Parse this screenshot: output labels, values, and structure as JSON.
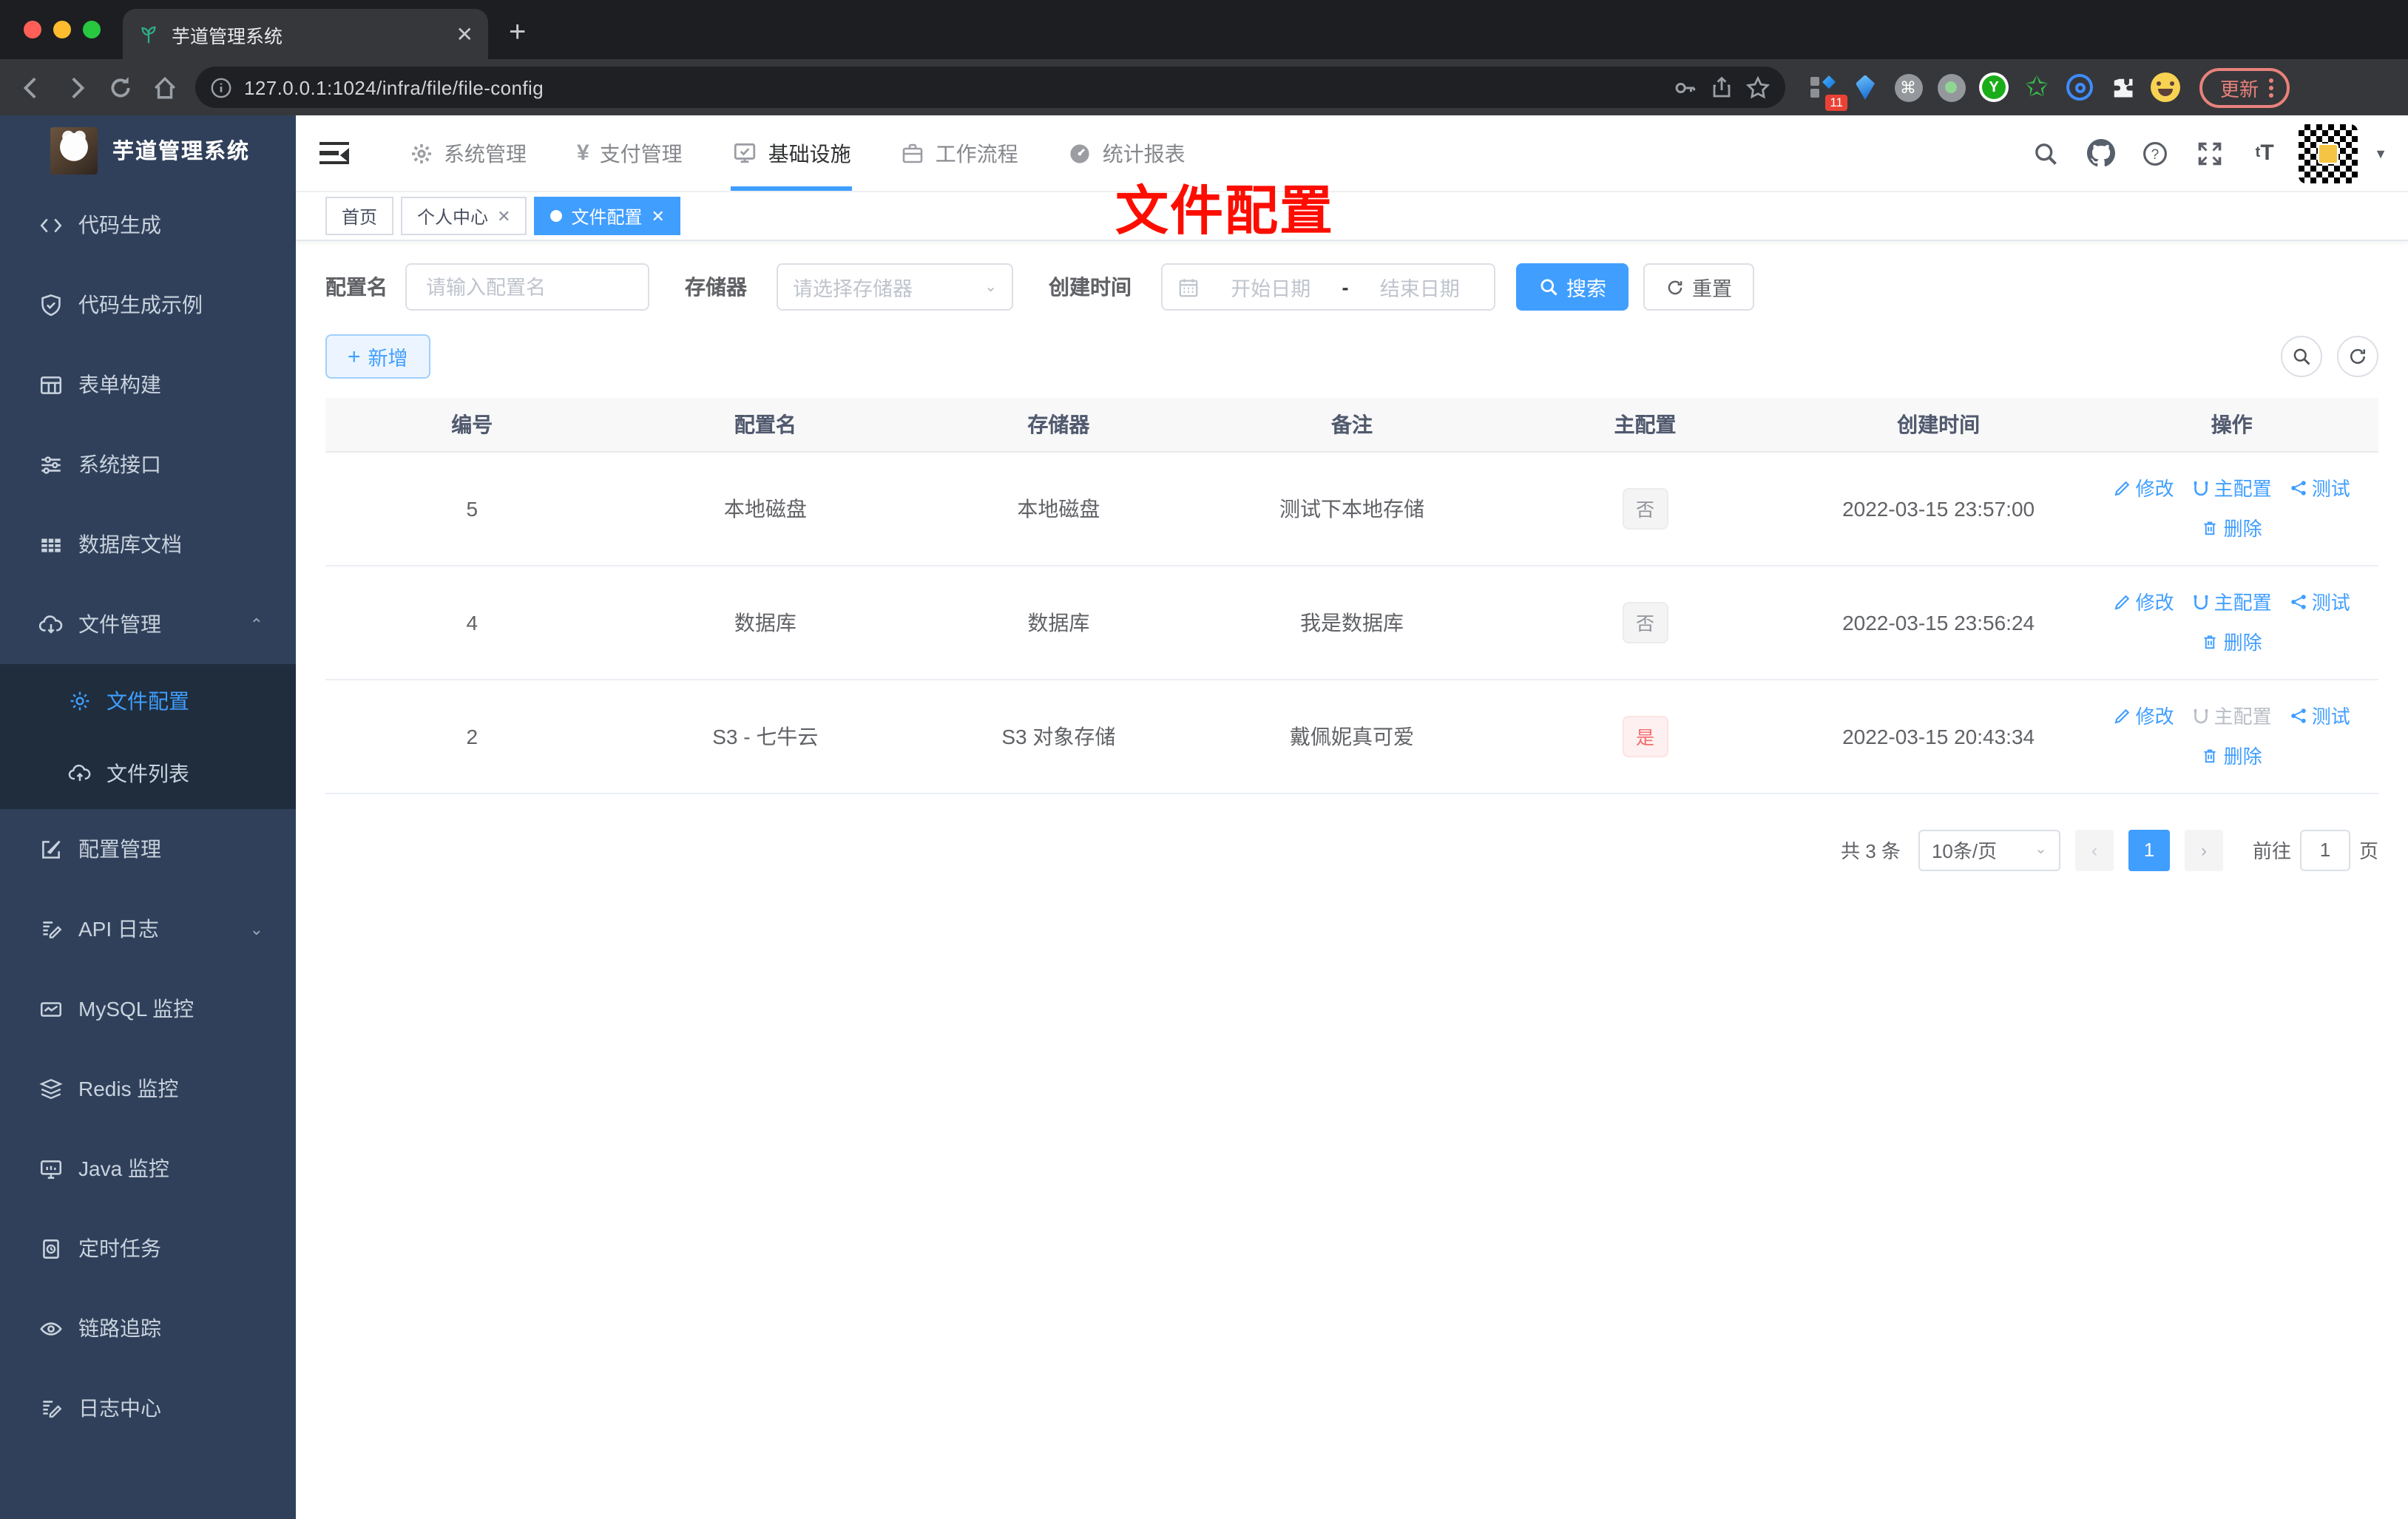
{
  "browser": {
    "tab_title": "芋道管理系统",
    "url": "127.0.0.1:1024/infra/file/file-config",
    "update_label": "更新",
    "extensions_badge": "11"
  },
  "sidebar": {
    "title": "芋道管理系统",
    "items": [
      {
        "label": "代码生成"
      },
      {
        "label": "代码生成示例"
      },
      {
        "label": "表单构建"
      },
      {
        "label": "系统接口"
      },
      {
        "label": "数据库文档"
      },
      {
        "label": "文件管理"
      },
      {
        "label": "文件配置"
      },
      {
        "label": "文件列表"
      },
      {
        "label": "配置管理"
      },
      {
        "label": "API 日志"
      },
      {
        "label": "MySQL 监控"
      },
      {
        "label": "Redis 监控"
      },
      {
        "label": "Java 监控"
      },
      {
        "label": "定时任务"
      },
      {
        "label": "链路追踪"
      },
      {
        "label": "日志中心"
      }
    ]
  },
  "topnav": {
    "items": [
      {
        "label": "系统管理"
      },
      {
        "label": "支付管理"
      },
      {
        "label": "基础设施"
      },
      {
        "label": "工作流程"
      },
      {
        "label": "统计报表"
      }
    ]
  },
  "tags": {
    "home": "首页",
    "profile": "个人中心",
    "current": "文件配置"
  },
  "annotation": {
    "title": "文件配置"
  },
  "filters": {
    "name_label": "配置名",
    "name_placeholder": "请输入配置名",
    "storage_label": "存储器",
    "storage_placeholder": "请选择存储器",
    "time_label": "创建时间",
    "start_placeholder": "开始日期",
    "separator": "-",
    "end_placeholder": "结束日期",
    "search_label": "搜索",
    "reset_label": "重置"
  },
  "toolbar": {
    "add_label": "新增"
  },
  "table": {
    "headers": [
      "编号",
      "配置名",
      "存储器",
      "备注",
      "主配置",
      "创建时间",
      "操作"
    ],
    "actions": {
      "edit": "修改",
      "master": "主配置",
      "test": "测试",
      "delete": "删除"
    },
    "rows": [
      {
        "id": "5",
        "name": "本地磁盘",
        "storage": "本地磁盘",
        "remark": "测试下本地存储",
        "master": "否",
        "created": "2022-03-15 23:57:00"
      },
      {
        "id": "4",
        "name": "数据库",
        "storage": "数据库",
        "remark": "我是数据库",
        "master": "否",
        "created": "2022-03-15 23:56:24"
      },
      {
        "id": "2",
        "name": "S3 - 七牛云",
        "storage": "S3 对象存储",
        "remark": "戴佩妮真可爱",
        "master": "是",
        "created": "2022-03-15 20:43:34"
      }
    ]
  },
  "pagination": {
    "total": "共 3 条",
    "page_size": "10条/页",
    "page": "1",
    "goto_label": "前往",
    "goto_value": "1",
    "unit": "页"
  },
  "colors": {
    "accent": "#409eff",
    "danger": "#f56c6c",
    "annotation_red": "#fd0d00",
    "sidebar_bg": "#31405a",
    "submenu_bg": "#1f2d3d"
  }
}
